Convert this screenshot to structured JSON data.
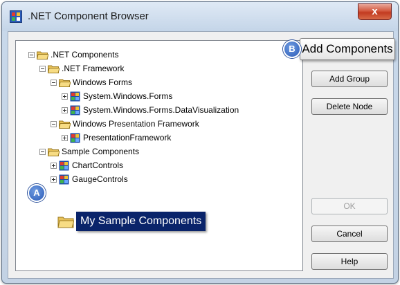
{
  "window": {
    "title": ".NET Component Browser",
    "close_glyph": "x"
  },
  "tree": {
    "nodes": [
      {
        "label": ".NET Components",
        "icon": "folder-open-icon",
        "expander": "minus"
      },
      {
        "label": ".NET Framework",
        "icon": "folder-open-icon",
        "expander": "minus"
      },
      {
        "label": "Windows Forms",
        "icon": "folder-open-icon",
        "expander": "minus"
      },
      {
        "label": "System.Windows.Forms",
        "icon": "component-icon",
        "expander": "plus"
      },
      {
        "label": "System.Windows.Forms.DataVisualization",
        "icon": "component-icon",
        "expander": "plus"
      },
      {
        "label": "Windows Presentation Framework",
        "icon": "folder-open-icon",
        "expander": "minus"
      },
      {
        "label": "PresentationFramework",
        "icon": "component-icon",
        "expander": "plus"
      },
      {
        "label": "Sample Components",
        "icon": "folder-open-icon",
        "expander": "minus"
      },
      {
        "label": "ChartControls",
        "icon": "component-icon",
        "expander": "plus"
      },
      {
        "label": "GaugeControls",
        "icon": "component-icon",
        "expander": "plus"
      }
    ],
    "selected": {
      "label": "My Sample Components",
      "icon": "folder-icon"
    }
  },
  "buttons": {
    "add_components": "Add Components",
    "add_group": "Add Group",
    "delete_node": "Delete Node",
    "ok": "OK",
    "cancel": "Cancel",
    "help": "Help"
  },
  "callouts": {
    "a": "A",
    "b": "B"
  },
  "colors": {
    "selection": "#0a246a",
    "callout": "#2a5bb8",
    "folder": "#f2d36b"
  }
}
